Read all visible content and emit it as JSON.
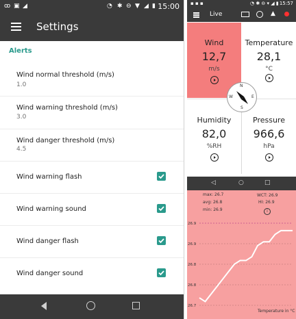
{
  "left": {
    "status": {
      "time": "15:00"
    },
    "header": {
      "title": "Settings"
    },
    "section": "Alerts",
    "prefs": [
      {
        "title": "Wind normal threshold (m/s)",
        "value": "1.0"
      },
      {
        "title": "Wind warning threshold (m/s)",
        "value": "3.0"
      },
      {
        "title": "Wind danger threshold (m/s)",
        "value": "4.5"
      }
    ],
    "checks": [
      {
        "title": "Wind warning flash",
        "checked": true
      },
      {
        "title": "Wind warning sound",
        "checked": true
      },
      {
        "title": "Wind danger flash",
        "checked": true
      },
      {
        "title": "Wind danger sound",
        "checked": true
      }
    ],
    "accent": "#2a9a8c"
  },
  "right": {
    "status": {
      "time": "15:57"
    },
    "header": {
      "title": "Live"
    },
    "tiles": {
      "wind": {
        "label": "Wind",
        "value": "12,7",
        "unit": "m/s"
      },
      "temperature": {
        "label": "Temperature",
        "value": "28,1",
        "unit": "°C"
      },
      "humidity": {
        "label": "Humidity",
        "value": "82,0",
        "unit": "%RH"
      },
      "pressure": {
        "label": "Pressure",
        "value": "966,6",
        "unit": "hPa"
      }
    },
    "compass": {
      "n": "N",
      "e": "E",
      "s": "S",
      "w": "W"
    },
    "chart": {
      "stats": {
        "max": "max: 26.7",
        "avg": "avg: 26.8",
        "min": "min: 26.9",
        "wct": "WCT: 26.9",
        "hi": "HI: 26.9"
      },
      "yticks": [
        "26.9",
        "26.9",
        "26.8",
        "26.8",
        "26.7"
      ],
      "caption": "Temperature in °C"
    },
    "alert_color": "#f47d7d"
  },
  "chart_data": {
    "type": "line",
    "title": "",
    "xlabel": "",
    "ylabel": "Temperature in °C",
    "series": [
      {
        "values": [
          26.71,
          26.7,
          26.72,
          26.74,
          26.76,
          26.78,
          26.8,
          26.81,
          26.81,
          26.82,
          26.85,
          26.86,
          26.86,
          26.88,
          26.89,
          26.89,
          26.89
        ]
      }
    ],
    "ylim": [
      26.69,
      26.91
    ],
    "grid": true
  }
}
